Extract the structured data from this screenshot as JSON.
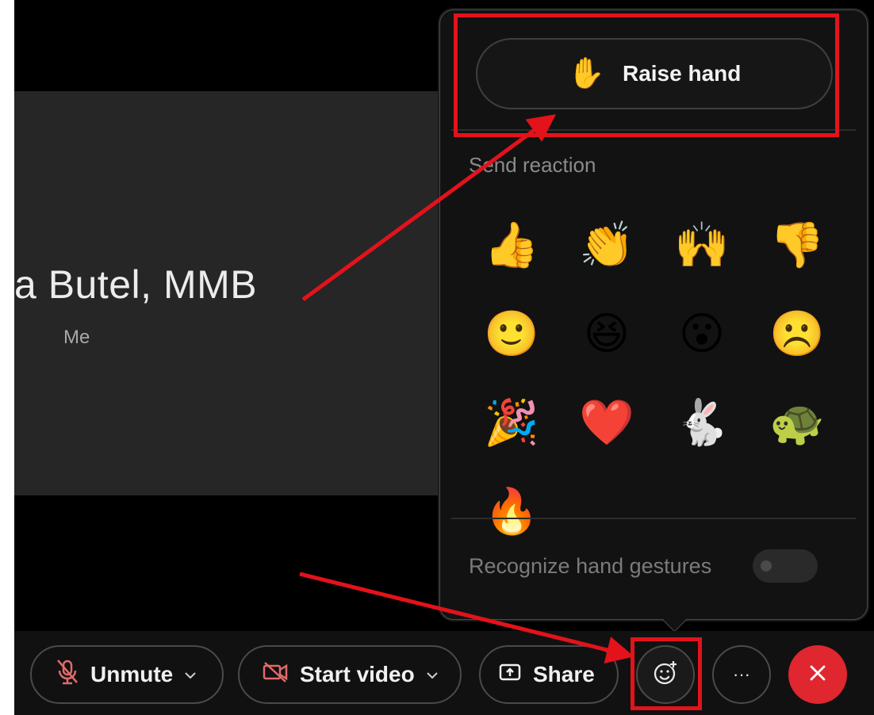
{
  "participant": {
    "name": "a Butel, MMB",
    "role": "Me"
  },
  "popover": {
    "raise_hand": {
      "emoji": "✋",
      "label": "Raise hand"
    },
    "section_label": "Send reaction",
    "reactions": [
      {
        "name": "thumbs-up",
        "glyph": "👍"
      },
      {
        "name": "clap",
        "glyph": "👏"
      },
      {
        "name": "celebrate",
        "glyph": "🙌"
      },
      {
        "name": "thumbs-down",
        "glyph": "👎"
      },
      {
        "name": "smile",
        "glyph": "🙂"
      },
      {
        "name": "laugh",
        "glyph": "😆"
      },
      {
        "name": "surprised",
        "glyph": "😮"
      },
      {
        "name": "sad",
        "glyph": "☹️"
      },
      {
        "name": "party",
        "glyph": "🎉"
      },
      {
        "name": "heart",
        "glyph": "❤️"
      },
      {
        "name": "speed-up",
        "glyph": "🐇"
      },
      {
        "name": "slow-down",
        "glyph": "🐢"
      },
      {
        "name": "fire",
        "glyph": "🔥"
      }
    ],
    "gestures_label": "Recognize hand gestures",
    "gestures_enabled": false
  },
  "controls": {
    "unmute": "Unmute",
    "start_video": "Start video",
    "share": "Share",
    "more": "···",
    "reactions_icon": "smiley-plus-icon",
    "leave_icon": "close-icon"
  },
  "colors": {
    "annotation": "#e3121b",
    "leave": "#e0262f",
    "muted_icon": "#e06a6a"
  }
}
